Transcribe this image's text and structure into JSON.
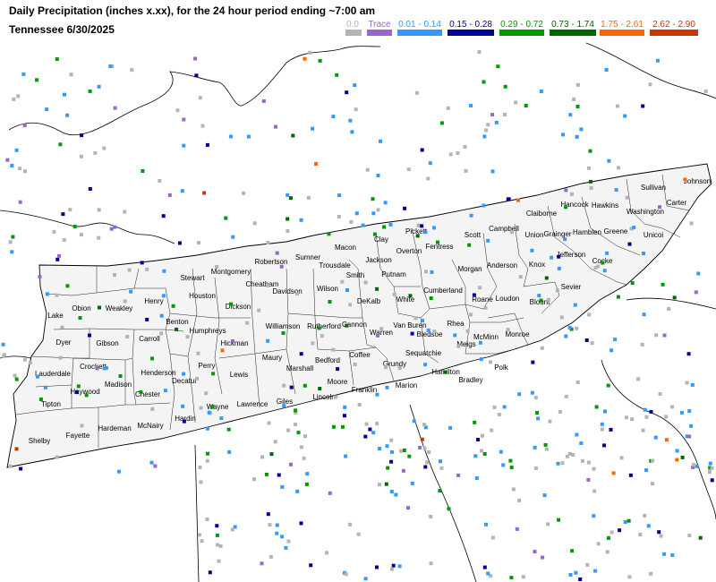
{
  "title": {
    "line1": "Daily Precipitation (inches  x.xx),  for the 24 hour period ending ~7:00 am",
    "line2": "Tennessee 6/30/2025"
  },
  "legend": [
    {
      "label": "0.0",
      "color": "#b4b4b4"
    },
    {
      "label": "Trace",
      "color": "#9966cc"
    },
    {
      "label": "0.01 - 0.14",
      "color": "#3399ff"
    },
    {
      "label": "0.15 - 0.28",
      "color": "#000099"
    },
    {
      "label": "0.29 - 0.72",
      "color": "#009900"
    },
    {
      "label": "0.73 - 1.74",
      "color": "#006600"
    },
    {
      "label": "1.75 - 2.61",
      "color": "#ff6600"
    },
    {
      "label": "2.62 - 2.90",
      "color": "#cc3300"
    }
  ],
  "counties": [
    "Stewart",
    "Montgomery",
    "Robertson",
    "Sumner",
    "Macon",
    "Clay",
    "Pickett",
    "Scott",
    "Campbell",
    "Claiborne",
    "Hancock",
    "Hawkins",
    "Sullivan",
    "Johnson",
    "Fentress",
    "Overton",
    "Jackson",
    "Trousdale",
    "Smith",
    "Union",
    "Grainger",
    "Hamblen",
    "Greene",
    "Washington",
    "Carter",
    "Unicoi",
    "Obion",
    "Weakley",
    "Henry",
    "Lake",
    "Houston",
    "Dickson",
    "Cheatham",
    "Davidson",
    "Wilson",
    "Putnam",
    "DeKalb",
    "White",
    "Cumberland",
    "Morgan",
    "Anderson",
    "Knox",
    "Jefferson",
    "Cocke",
    "Sevier",
    "Blount",
    "Loudon",
    "Roane",
    "Dyer",
    "Gibson",
    "Carroll",
    "Benton",
    "Humphreys",
    "Hickman",
    "Williamson",
    "Rutherford",
    "Cannon",
    "Warren",
    "Van Buren",
    "Bledsoe",
    "Rhea",
    "Meigs",
    "McMinn",
    "Monroe",
    "Lauderdale",
    "Crockett",
    "Madison",
    "Henderson",
    "Perry",
    "Lewis",
    "Maury",
    "Marshall",
    "Bedford",
    "Coffee",
    "Grundy",
    "Sequatchie",
    "Hamilton",
    "Bradley",
    "Polk",
    "Haywood",
    "Chester",
    "Decatur",
    "Tipton",
    "Hardeman",
    "McNairy",
    "Hardin",
    "Wayne",
    "Lawrence",
    "Giles",
    "Lincoln",
    "Moore",
    "Franklin",
    "Marion",
    "Shelby",
    "Fayette"
  ]
}
